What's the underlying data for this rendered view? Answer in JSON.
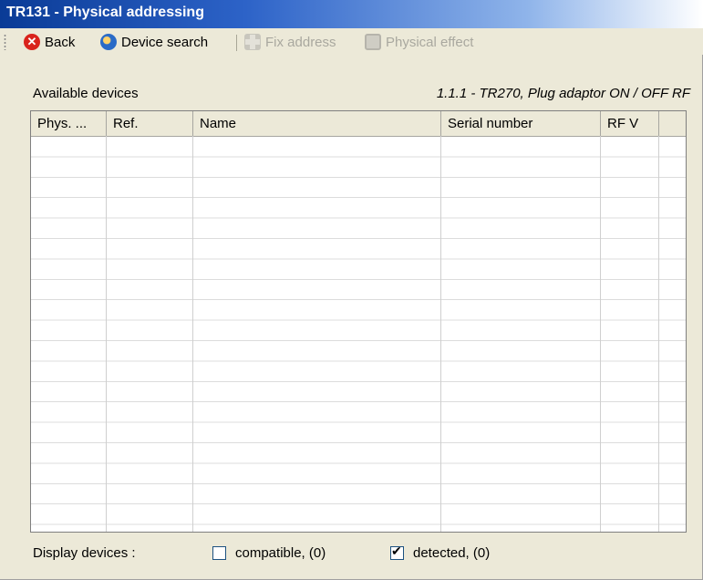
{
  "window": {
    "title": "TR131 - Physical addressing"
  },
  "toolbar": {
    "back": {
      "label": "Back",
      "icon": "back-icon"
    },
    "device_search": {
      "label": "Device search",
      "icon": "device-search-icon"
    },
    "fix_address": {
      "label": "Fix address",
      "icon": "fix-address-icon",
      "enabled": false
    },
    "physical_effect": {
      "label": "Physical effect",
      "icon": "physical-effect-icon",
      "enabled": false
    }
  },
  "panel": {
    "available_label": "Available devices",
    "selected_device": "1.1.1 - TR270, Plug adaptor ON / OFF RF"
  },
  "table": {
    "columns": [
      "Phys. ...",
      "Ref.",
      "Name",
      "Serial number",
      "RF V",
      ""
    ],
    "rows": []
  },
  "footer": {
    "display_label": "Display devices :",
    "compatible": {
      "label": "compatible, (0)",
      "checked": false
    },
    "detected": {
      "label": "detected, (0)",
      "checked": true
    }
  }
}
